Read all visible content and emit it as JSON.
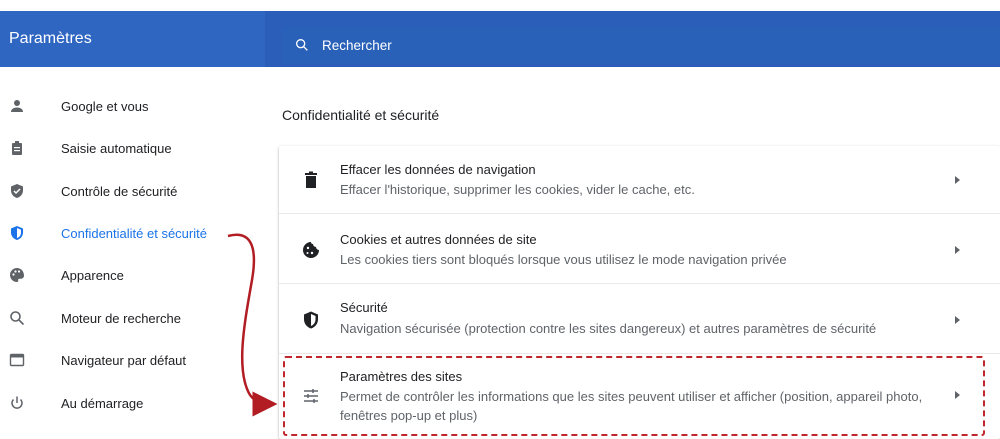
{
  "app": {
    "title": "Paramètres"
  },
  "search": {
    "placeholder": "Rechercher"
  },
  "sidebar": {
    "items": [
      {
        "label": "Google et vous",
        "icon": "person-icon"
      },
      {
        "label": "Saisie automatique",
        "icon": "clipboard-icon"
      },
      {
        "label": "Contrôle de sécurité",
        "icon": "shield-check-icon"
      },
      {
        "label": "Confidentialité et sécurité",
        "icon": "shield-icon",
        "active": true
      },
      {
        "label": "Apparence",
        "icon": "palette-icon"
      },
      {
        "label": "Moteur de recherche",
        "icon": "search-icon"
      },
      {
        "label": "Navigateur par défaut",
        "icon": "browser-icon"
      },
      {
        "label": "Au démarrage",
        "icon": "power-icon"
      }
    ]
  },
  "main": {
    "section_title": "Confidentialité et sécurité",
    "rows": [
      {
        "title": "Effacer les données de navigation",
        "subtitle": "Effacer l'historique, supprimer les cookies, vider le cache, etc.",
        "icon": "trash-icon"
      },
      {
        "title": "Cookies et autres données de site",
        "subtitle": "Les cookies tiers sont bloqués lorsque vous utilisez le mode navigation privée",
        "icon": "cookie-icon"
      },
      {
        "title": "Sécurité",
        "subtitle": "Navigation sécurisée (protection contre les sites dangereux) et autres paramètres de sécurité",
        "icon": "shield-icon"
      },
      {
        "title": "Paramètres des sites",
        "subtitle": "Permet de contrôler les informations que les sites peuvent utiliser et afficher (position, appareil photo, fenêtres pop-up et plus)",
        "icon": "tune-icon"
      }
    ]
  },
  "colors": {
    "header": "#2f66c2",
    "search_bar": "#2961b9",
    "active": "#1a73e8",
    "annotation": "#c0272d"
  }
}
